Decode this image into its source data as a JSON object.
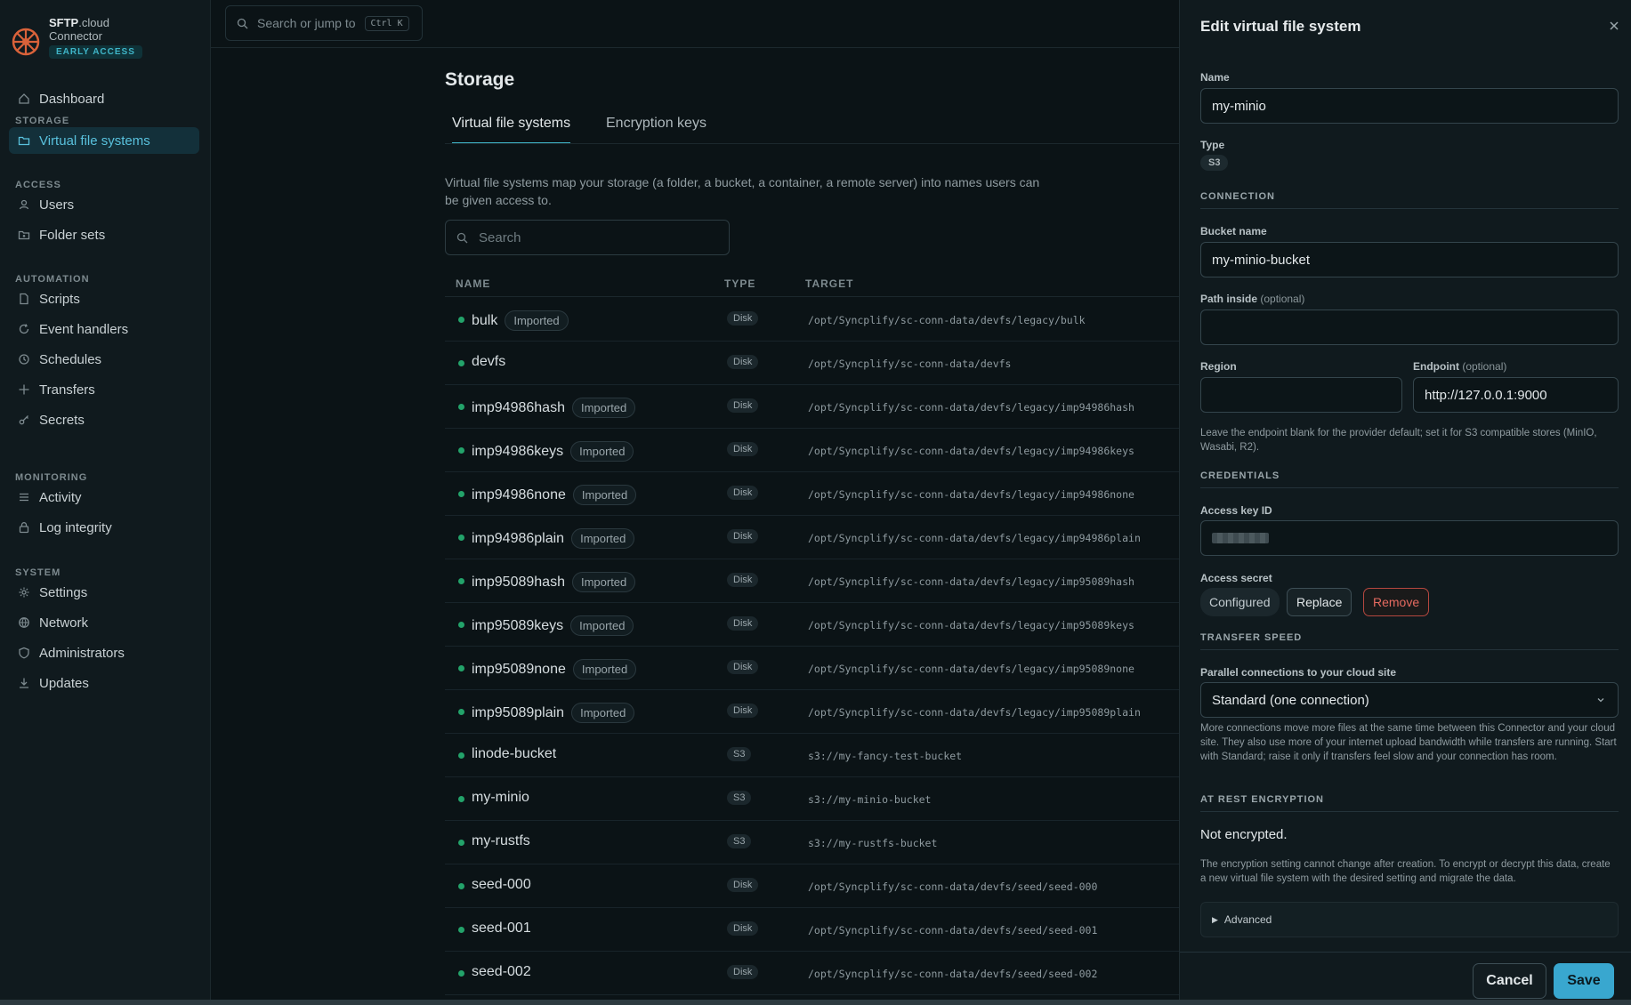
{
  "brand": {
    "name_bold": "SFTP",
    "name_rest": ".cloud",
    "sub": "Connector",
    "badge": "EARLY ACCESS"
  },
  "topbar": {
    "search_placeholder": "Search or jump to",
    "shortcut": "Ctrl K"
  },
  "sidebar": {
    "dashboard": "Dashboard",
    "sections": [
      "STORAGE",
      "ACCESS",
      "AUTOMATION",
      "MONITORING",
      "SYSTEM"
    ],
    "items": [
      {
        "label": "Virtual file systems",
        "icon": "folder-icon"
      },
      {
        "label": "Users",
        "icon": "user-icon"
      },
      {
        "label": "Folder sets",
        "icon": "folder-set-icon"
      },
      {
        "label": "Scripts",
        "icon": "file-icon"
      },
      {
        "label": "Event handlers",
        "icon": "refresh-icon"
      },
      {
        "label": "Schedules",
        "icon": "clock-icon"
      },
      {
        "label": "Transfers",
        "icon": "arrows-icon"
      },
      {
        "label": "Secrets",
        "icon": "key-icon"
      },
      {
        "label": "Activity",
        "icon": "list-icon"
      },
      {
        "label": "Log integrity",
        "icon": "lock-icon"
      },
      {
        "label": "Settings",
        "icon": "gear-icon"
      },
      {
        "label": "Network",
        "icon": "globe-icon"
      },
      {
        "label": "Administrators",
        "icon": "shield-icon"
      },
      {
        "label": "Updates",
        "icon": "download-icon"
      }
    ]
  },
  "main": {
    "title": "Storage",
    "tabs": [
      "Virtual file systems",
      "Encryption keys"
    ],
    "description": "Virtual file systems map your storage (a folder, a bucket, a container, a remote server) into names users can be given access to.",
    "search_placeholder": "Search",
    "columns": [
      "NAME",
      "TYPE",
      "TARGET"
    ],
    "rows": [
      {
        "name": "bulk",
        "tag": "Imported",
        "type": "Disk",
        "target": "/opt/Syncplify/sc-conn-data/devfs/legacy/bulk"
      },
      {
        "name": "devfs",
        "tag": "",
        "type": "Disk",
        "target": "/opt/Syncplify/sc-conn-data/devfs"
      },
      {
        "name": "imp94986hash",
        "tag": "Imported",
        "type": "Disk",
        "target": "/opt/Syncplify/sc-conn-data/devfs/legacy/imp94986hash"
      },
      {
        "name": "imp94986keys",
        "tag": "Imported",
        "type": "Disk",
        "target": "/opt/Syncplify/sc-conn-data/devfs/legacy/imp94986keys"
      },
      {
        "name": "imp94986none",
        "tag": "Imported",
        "type": "Disk",
        "target": "/opt/Syncplify/sc-conn-data/devfs/legacy/imp94986none"
      },
      {
        "name": "imp94986plain",
        "tag": "Imported",
        "type": "Disk",
        "target": "/opt/Syncplify/sc-conn-data/devfs/legacy/imp94986plain"
      },
      {
        "name": "imp95089hash",
        "tag": "Imported",
        "type": "Disk",
        "target": "/opt/Syncplify/sc-conn-data/devfs/legacy/imp95089hash"
      },
      {
        "name": "imp95089keys",
        "tag": "Imported",
        "type": "Disk",
        "target": "/opt/Syncplify/sc-conn-data/devfs/legacy/imp95089keys"
      },
      {
        "name": "imp95089none",
        "tag": "Imported",
        "type": "Disk",
        "target": "/opt/Syncplify/sc-conn-data/devfs/legacy/imp95089none"
      },
      {
        "name": "imp95089plain",
        "tag": "Imported",
        "type": "Disk",
        "target": "/opt/Syncplify/sc-conn-data/devfs/legacy/imp95089plain"
      },
      {
        "name": "linode-bucket",
        "tag": "",
        "type": "S3",
        "target": "s3://my-fancy-test-bucket"
      },
      {
        "name": "my-minio",
        "tag": "",
        "type": "S3",
        "target": "s3://my-minio-bucket"
      },
      {
        "name": "my-rustfs",
        "tag": "",
        "type": "S3",
        "target": "s3://my-rustfs-bucket"
      },
      {
        "name": "seed-000",
        "tag": "",
        "type": "Disk",
        "target": "/opt/Syncplify/sc-conn-data/devfs/seed/seed-000"
      },
      {
        "name": "seed-001",
        "tag": "",
        "type": "Disk",
        "target": "/opt/Syncplify/sc-conn-data/devfs/seed/seed-001"
      },
      {
        "name": "seed-002",
        "tag": "",
        "type": "Disk",
        "target": "/opt/Syncplify/sc-conn-data/devfs/seed/seed-002"
      }
    ]
  },
  "drawer": {
    "title": "Edit virtual file system",
    "name_label": "Name",
    "name_value": "my-minio",
    "type_label": "Type",
    "type_value": "S3",
    "connection_heading": "CONNECTION",
    "bucket_label": "Bucket name",
    "bucket_value": "my-minio-bucket",
    "path_label": "Path inside",
    "path_optional": "(optional)",
    "path_value": "",
    "region_label": "Region",
    "region_value": "",
    "endpoint_label": "Endpoint",
    "endpoint_optional": "(optional)",
    "endpoint_value": "http://127.0.0.1:9000",
    "endpoint_help": "Leave the endpoint blank for the provider default; set it for S3 compatible stores (MinIO, Wasabi, R2).",
    "credentials_heading": "CREDENTIALS",
    "access_key_label": "Access key ID",
    "access_secret_label": "Access secret",
    "secret_status": "Configured",
    "replace_label": "Replace",
    "remove_label": "Remove",
    "speed_heading": "TRANSFER SPEED",
    "parallel_label": "Parallel connections to your cloud site",
    "parallel_value": "Standard (one connection)",
    "parallel_help": "More connections move more files at the same time between this Connector and your cloud site. They also use more of your internet upload bandwidth while transfers are running. Start with Standard; raise it only if transfers feel slow and your connection has room.",
    "encryption_heading": "AT REST ENCRYPTION",
    "encryption_status": "Not encrypted.",
    "encryption_help": "The encryption setting cannot change after creation. To encrypt or decrypt this data, create a new virtual file system with the desired setting and migrate the data.",
    "advanced_label": "Advanced",
    "cancel_label": "Cancel",
    "save_label": "Save"
  }
}
